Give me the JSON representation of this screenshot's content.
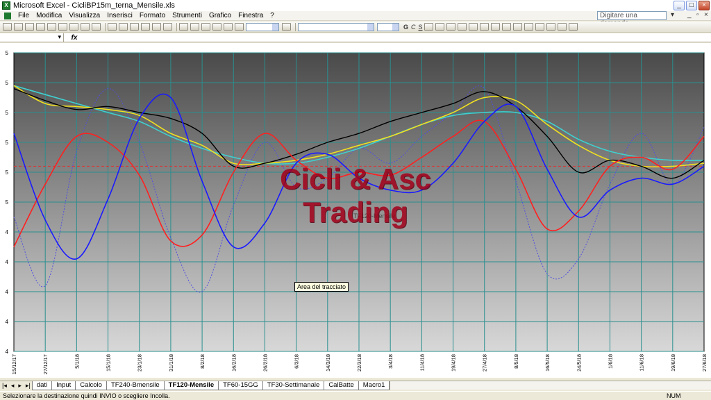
{
  "window": {
    "title": "Microsoft Excel - CicliBP15m_terna_Mensile.xls",
    "app_icon": "excel-icon"
  },
  "menu": {
    "items": [
      "File",
      "Modifica",
      "Visualizza",
      "Inserisci",
      "Formato",
      "Strumenti",
      "Grafico",
      "Finestra",
      "?"
    ],
    "help_placeholder": "Digitare una domanda."
  },
  "formula": {
    "fx_label": "fx"
  },
  "chart": {
    "watermark_line1": "Cicli & Asc",
    "watermark_line2": "Trading",
    "tooltip": "Area del tracciato",
    "series_label": "TF120-Mensile",
    "colors": {
      "background_top": "#4a4a4a",
      "background_bottom": "#d8d8d8",
      "grid": "#2a8f8f",
      "price": "#000000",
      "yellow_avg": "#f0e020",
      "cyan_avg": "#40d0d0",
      "red_cycle": "#ff2020",
      "blue_cycle": "#1a1aff",
      "blue_dotted": "#5050e0",
      "red_dashed": "#e03030"
    }
  },
  "chart_data": {
    "type": "line",
    "y_ticks": [
      "5",
      "5",
      "5",
      "5",
      "5",
      "5",
      "4",
      "4",
      "4",
      "4",
      "4"
    ],
    "x_ticks": [
      "15/12/17",
      "27/12/17",
      "5/1/18",
      "15/1/18",
      "23/1/18",
      "31/1/18",
      "8/2/18",
      "16/2/18",
      "26/2/18",
      "6/3/18",
      "14/3/18",
      "22/3/18",
      "3/4/18",
      "11/4/18",
      "19/4/18",
      "27/4/18",
      "8/5/18",
      "16/5/18",
      "24/5/18",
      "1/6/18",
      "11/6/18",
      "19/6/18",
      "27/6/18"
    ],
    "grid": true,
    "ylim": [
      0,
      10
    ],
    "series": [
      {
        "key": "black",
        "x": [
          0,
          1,
          2,
          3,
          4,
          5,
          6,
          7,
          8,
          9,
          10,
          11,
          12,
          13,
          14,
          15,
          16,
          17,
          18,
          19,
          20,
          21,
          22
        ],
        "values": [
          8.8,
          8.4,
          8.1,
          8.2,
          8.0,
          7.8,
          7.3,
          6.2,
          6.3,
          6.6,
          7.0,
          7.3,
          7.7,
          8.0,
          8.3,
          8.7,
          8.2,
          7.2,
          6.0,
          6.4,
          6.2,
          5.8,
          6.4
        ]
      },
      {
        "key": "yellow",
        "x": [
          0,
          1,
          2,
          3,
          4,
          5,
          6,
          7,
          8,
          9,
          10,
          11,
          12,
          13,
          14,
          15,
          16,
          17,
          18,
          19,
          20,
          21,
          22
        ],
        "values": [
          8.9,
          8.3,
          8.2,
          8.1,
          7.9,
          7.3,
          6.9,
          6.3,
          6.3,
          6.4,
          6.6,
          6.9,
          7.2,
          7.6,
          8.0,
          8.5,
          8.4,
          7.6,
          6.9,
          6.4,
          6.2,
          6.2,
          6.3
        ]
      },
      {
        "key": "cyan",
        "x": [
          0,
          1,
          2,
          3,
          4,
          5,
          6,
          7,
          8,
          9,
          10,
          11,
          12,
          13,
          14,
          15,
          16,
          17,
          18,
          19,
          20,
          21,
          22
        ],
        "values": [
          8.9,
          8.6,
          8.3,
          8.0,
          7.7,
          7.2,
          6.8,
          6.5,
          6.3,
          6.3,
          6.5,
          6.8,
          7.2,
          7.6,
          7.9,
          8.0,
          8.0,
          7.7,
          7.1,
          6.7,
          6.5,
          6.4,
          6.4
        ]
      },
      {
        "key": "red",
        "x": [
          0,
          1,
          2,
          3,
          4,
          5,
          6,
          7,
          8,
          9,
          10,
          11,
          12,
          13,
          14,
          15,
          16,
          17,
          18,
          19,
          20,
          21,
          22
        ],
        "values": [
          3.5,
          5.6,
          7.2,
          7.0,
          5.9,
          3.7,
          3.9,
          6.0,
          7.3,
          6.4,
          5.8,
          6.0,
          5.9,
          6.5,
          7.2,
          7.7,
          6.1,
          4.1,
          4.7,
          6.2,
          6.5,
          6.1,
          7.2
        ]
      },
      {
        "key": "blue",
        "x": [
          0,
          1,
          2,
          3,
          4,
          5,
          6,
          7,
          8,
          9,
          10,
          11,
          12,
          13,
          14,
          15,
          16,
          17,
          18,
          19,
          20,
          21,
          22
        ],
        "values": [
          7.3,
          4.4,
          3.1,
          5.1,
          7.8,
          8.5,
          5.7,
          3.5,
          4.3,
          6.3,
          6.6,
          5.8,
          5.4,
          5.4,
          6.3,
          7.7,
          8.2,
          6.1,
          4.5,
          5.4,
          5.8,
          5.6,
          6.2
        ]
      },
      {
        "key": "blue_dotted",
        "x": [
          0,
          1,
          2,
          3,
          4,
          5,
          6,
          7,
          8,
          9,
          10,
          11,
          12,
          13,
          14,
          15,
          16,
          17,
          18,
          19,
          20,
          21,
          22
        ],
        "values": [
          4.5,
          2.2,
          6.7,
          8.8,
          7.0,
          3.8,
          2.0,
          4.9,
          7.0,
          5.5,
          5.8,
          6.8,
          6.3,
          7.2,
          8.0,
          8.8,
          5.7,
          2.6,
          3.1,
          5.6,
          7.3,
          5.6,
          7.5
        ]
      }
    ],
    "reference_line": 6.2
  },
  "tabs": {
    "nav": [
      "|◂",
      "◂",
      "▸",
      "▸|"
    ],
    "items": [
      "dati",
      "Input",
      "Calcolo",
      "TF240-Bmensile",
      "TF120-Mensile",
      "TF60-15GG",
      "TF30-Settimanale",
      "CalBatte",
      "Macro1"
    ],
    "active": "TF120-Mensile"
  },
  "status": {
    "message": "Selezionare la destinazione quindi INVIO o scegliere Incolla.",
    "num": "NUM"
  }
}
